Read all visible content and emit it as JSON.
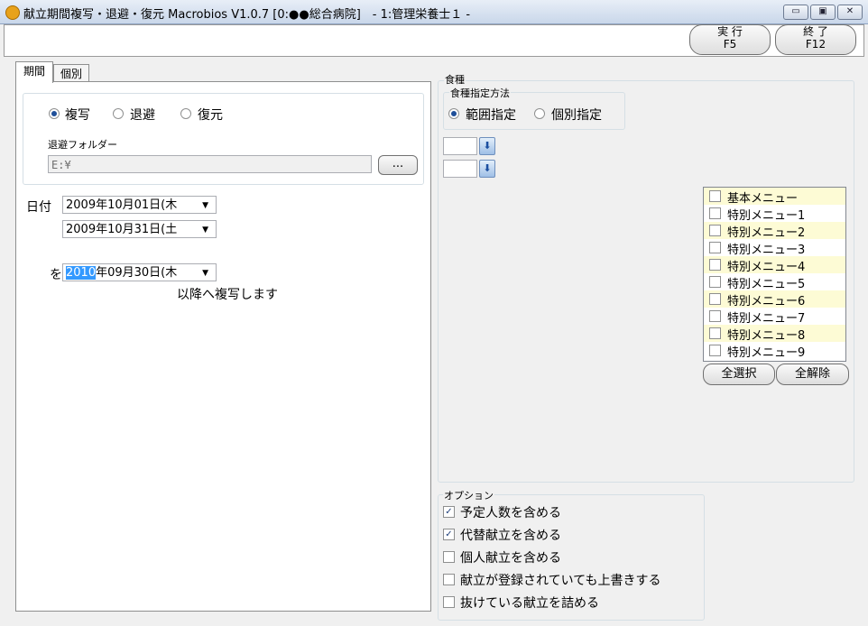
{
  "window": {
    "title": "献立期間複写・退避・復元 Macrobios V1.0.7 [0:●●総合病院]　- 1:管理栄養士１ -",
    "minimize": "▭",
    "maximize": "▣",
    "close": "✕"
  },
  "toolbar": {
    "run_label": "実 行",
    "run_key": "F5",
    "exit_label": "終 了",
    "exit_key": "F12"
  },
  "tabs": [
    {
      "label": "期間",
      "active": true
    },
    {
      "label": "個別",
      "active": false
    }
  ],
  "mode": {
    "options": [
      "複写",
      "退避",
      "復元"
    ],
    "selected": "複写"
  },
  "folder": {
    "label": "退避フォルダー",
    "value": "E:¥",
    "browse_label": "..."
  },
  "dates": {
    "label": "日付",
    "from": "2009年10月01日(木",
    "to": "2009年10月31日(土",
    "target_prefix": "を",
    "target_year_selected": "2010",
    "target_rest": "年09月30日(木",
    "suffix_text": "以降へ複写します"
  },
  "meal_type": {
    "group_label": "食種",
    "method_label": "食種指定方法",
    "options": [
      "範囲指定",
      "個別指定"
    ],
    "selected": "範囲指定",
    "spin_from": "",
    "spin_to": ""
  },
  "menus": {
    "items": [
      {
        "label": "基本メニュー",
        "checked": false,
        "highlight": true
      },
      {
        "label": "特別メニュー1",
        "checked": false,
        "highlight": false
      },
      {
        "label": "特別メニュー2",
        "checked": false,
        "highlight": true
      },
      {
        "label": "特別メニュー3",
        "checked": false,
        "highlight": false
      },
      {
        "label": "特別メニュー4",
        "checked": false,
        "highlight": true
      },
      {
        "label": "特別メニュー5",
        "checked": false,
        "highlight": false
      },
      {
        "label": "特別メニュー6",
        "checked": false,
        "highlight": true
      },
      {
        "label": "特別メニュー7",
        "checked": false,
        "highlight": false
      },
      {
        "label": "特別メニュー8",
        "checked": false,
        "highlight": true
      },
      {
        "label": "特別メニュー9",
        "checked": false,
        "highlight": false
      }
    ],
    "select_all_label": "全選択",
    "clear_all_label": "全解除",
    "highlight_color": "#fdfbd5"
  },
  "options": {
    "group_label": "オプション",
    "items": [
      {
        "label": "予定人数を含める",
        "checked": true
      },
      {
        "label": "代替献立を含める",
        "checked": true
      },
      {
        "label": "個人献立を含める",
        "checked": false
      },
      {
        "label": "献立が登録されていても上書きする",
        "checked": false
      },
      {
        "label": "抜けている献立を詰める",
        "checked": false
      }
    ]
  },
  "colors": {
    "selection": "#3399ff",
    "accent": "#1f4f99"
  }
}
